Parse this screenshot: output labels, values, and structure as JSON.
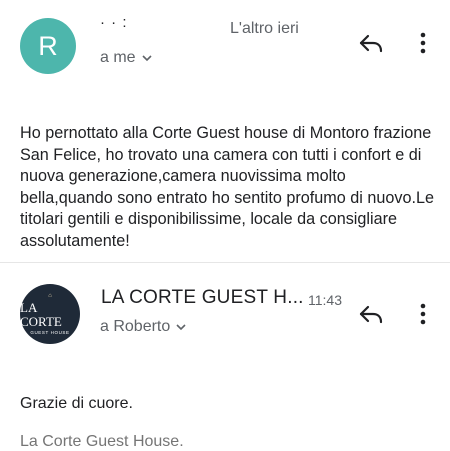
{
  "messages": [
    {
      "avatar_letter": "R",
      "avatar_color": "#4db6ac",
      "sender": "·                 ·   :",
      "time": "L'altro ieri",
      "recipient": "a me",
      "body": "Ho pernottato alla Corte Guest house  di Montoro frazione San Felice, ho trovato una camera con tutti i confort e di nuova generazione,camera nuovissima molto bella,quando sono entrato ho sentito profumo di nuovo.Le titolari gentili e disponibilissime, locale da consigliare assolutamente!"
    },
    {
      "avatar_logo_title": "LA CORTE",
      "avatar_logo_subtitle": "GUEST HOUSE",
      "avatar_color": "#1f2a38",
      "sender": "LA CORTE GUEST H...",
      "time": "11:43",
      "recipient": "a Roberto",
      "body": "Grazie di cuore.",
      "signature": "La Corte Guest House."
    }
  ],
  "icons": {
    "reply": "reply-arrow-icon",
    "more": "more-vertical-icon",
    "expand": "chevron-down-icon"
  }
}
